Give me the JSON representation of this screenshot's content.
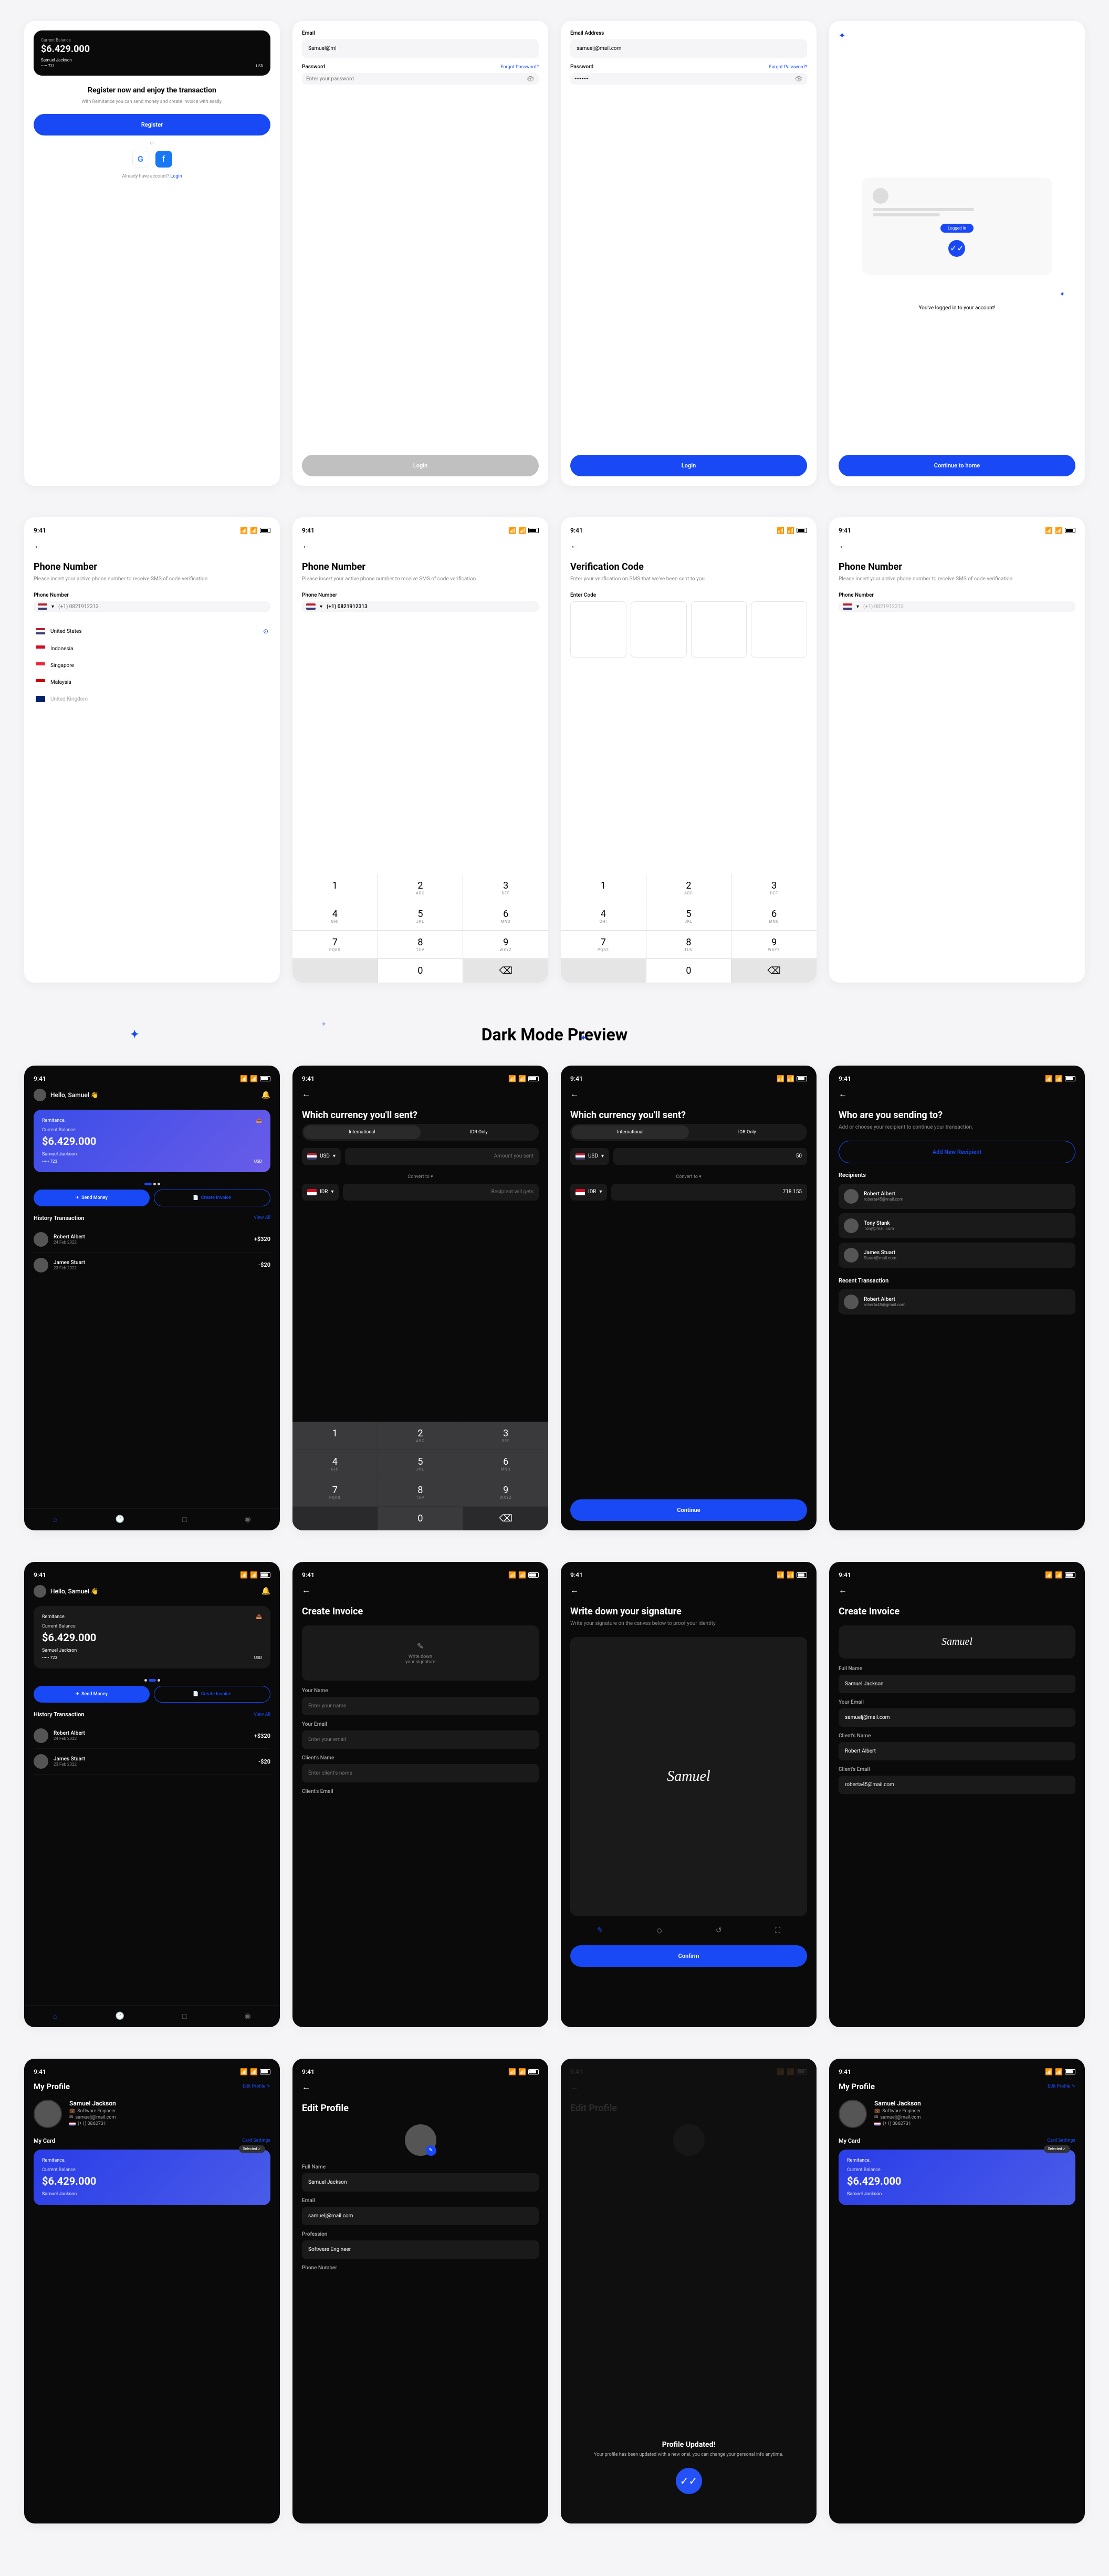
{
  "status": {
    "time": "9:41"
  },
  "register": {
    "balance": "$6.429.000",
    "name": "Samuel Jackson",
    "card_dots": "••••• 723",
    "currency": "USD",
    "current_balance": "Current Balance",
    "title": "Register now and enjoy the transaction",
    "subtitle": "With Remitance you can send money and create invoice with easily.",
    "btn": "Register",
    "or": "or",
    "already": "Already have account?",
    "login": "Login"
  },
  "login1": {
    "email_label": "Email",
    "email_val": "Samuel@m|",
    "pwd_label": "Password",
    "forgot": "Forgot Password?",
    "pwd_ph": "Enter your password",
    "btn": "Login"
  },
  "login2": {
    "email_label": "Email Address",
    "email_val": "samuelj@mail.com",
    "pwd_label": "Password",
    "forgot": "Forgot Password?",
    "pwd_val": "••••••••",
    "btn": "Login"
  },
  "login_success": {
    "badge": "Logged in",
    "msg": "You've logged in to your account!",
    "btn": "Continue to home"
  },
  "phone": {
    "title": "Phone Number",
    "subtitle": "Please insert your active phone number to receive SMS of code verification",
    "label": "Phone Number",
    "ph": "(+1) 0821912313",
    "val": "(+1) 0821912313"
  },
  "countries": {
    "us": "United States",
    "id": "Indonesia",
    "sg": "Singapore",
    "my": "Malaysia",
    "uk": "United Kingdom"
  },
  "verify": {
    "title": "Verification Code",
    "subtitle": "Enter your verification on SMS that we've been sent to you.",
    "label": "Enter Code"
  },
  "keys": {
    "k1": "1",
    "k2": "2",
    "k2l": "ABC",
    "k3": "3",
    "k3l": "DEF",
    "k4": "4",
    "k4l": "GHI",
    "k5": "5",
    "k5l": "JKL",
    "k6": "6",
    "k6l": "MNO",
    "k7": "7",
    "k7l": "PQRS",
    "k8": "8",
    "k8l": "TUV",
    "k9": "9",
    "k9l": "WXYZ",
    "k0": "0"
  },
  "section_dark": "Dark Mode Preview",
  "home": {
    "greeting": "Hello, Samuel 👋",
    "brand": "Remitance.",
    "bal_label": "Current Balance",
    "balance": "$6.429.000",
    "name": "Samuel Jackson",
    "card": "••••• 723",
    "curr": "USD",
    "send": "Send Money",
    "invoice": "Create Invoice",
    "hist_title": "History Transaction",
    "view_all": "View All",
    "t1_name": "Robert Albert",
    "t1_date": "24 Feb 2022",
    "t1_amt": "+$320",
    "t2_name": "James Stuart",
    "t2_date": "23 Feb 2022",
    "t2_amt": "-$20"
  },
  "currency": {
    "title": "Which currency you'll sent?",
    "tab1": "International",
    "tab2": "IDR Only",
    "usd": "USD",
    "idr": "IDR",
    "amount_ph": "Amount you sent",
    "gets_ph": "Recipient will gets",
    "convert": "Convert to",
    "amount": "50",
    "result": "718.155",
    "continue": "Continue"
  },
  "recipient": {
    "title": "Who are you sending to?",
    "subtitle": "Add or choose your recipient to continue your transaction.",
    "add": "Add New Recipient",
    "sec1": "Recipients",
    "sec2": "Recent Transaction",
    "r1_name": "Robert Albert",
    "r1_email": "roberta45@mail.com",
    "r2_name": "Tony Stank",
    "r2_email": "Tony@mail.com",
    "r3_name": "James Stuart",
    "r3_email": "Stuart@mail.com",
    "r4_name": "Robert Albert",
    "r4_email": "roberta45@gmail.com"
  },
  "invoice": {
    "title": "Create Invoice",
    "sig_hint": "Write down\nyour signature",
    "name_label": "Your Name",
    "name_ph": "Enter your name",
    "email_label": "Your Email",
    "email_ph": "Enter your email",
    "cname_label": "Client's Name",
    "cname_ph": "Enter client's name",
    "cemail_label": "Client's Email"
  },
  "invoice2": {
    "sig": "Samuel",
    "name_val": "Samuel Jackson",
    "email_val": "samuelj@mail.com",
    "cname_val": "Robert Albert",
    "cemail_val": "roberta45@mail.com",
    "full_name": "Full Name"
  },
  "signature": {
    "title": "Write down your signature",
    "subtitle": "Write your signature on the canvas below to proof your identity.",
    "sig": "Samuel",
    "confirm": "Confirm"
  },
  "profile": {
    "title": "My Profile",
    "edit": "Edit Profile ✎",
    "name": "Samuel Jackson",
    "job": "Software Engineer",
    "email": "samuelj@mail.com",
    "phone": "(+1) 0862731",
    "card_title": "My Card",
    "card_settings": "Card Settings",
    "selected": "Selected ✓",
    "brand": "Remitance.",
    "bal_label": "Current Balance",
    "balance": "$6.429.000"
  },
  "edit_profile": {
    "title": "Edit Profile",
    "name_label": "Full Name",
    "name_val": "Samuel Jackson",
    "email_label": "Email",
    "email_val": "samuelj@mail.com",
    "prof_label": "Profession",
    "prof_val": "Software Engineer",
    "phone_label": "Phone Number"
  },
  "updated": {
    "title": "Profile Updated!",
    "subtitle": "Your profile has been updated with a new one!, you can change your personal info anytime."
  }
}
